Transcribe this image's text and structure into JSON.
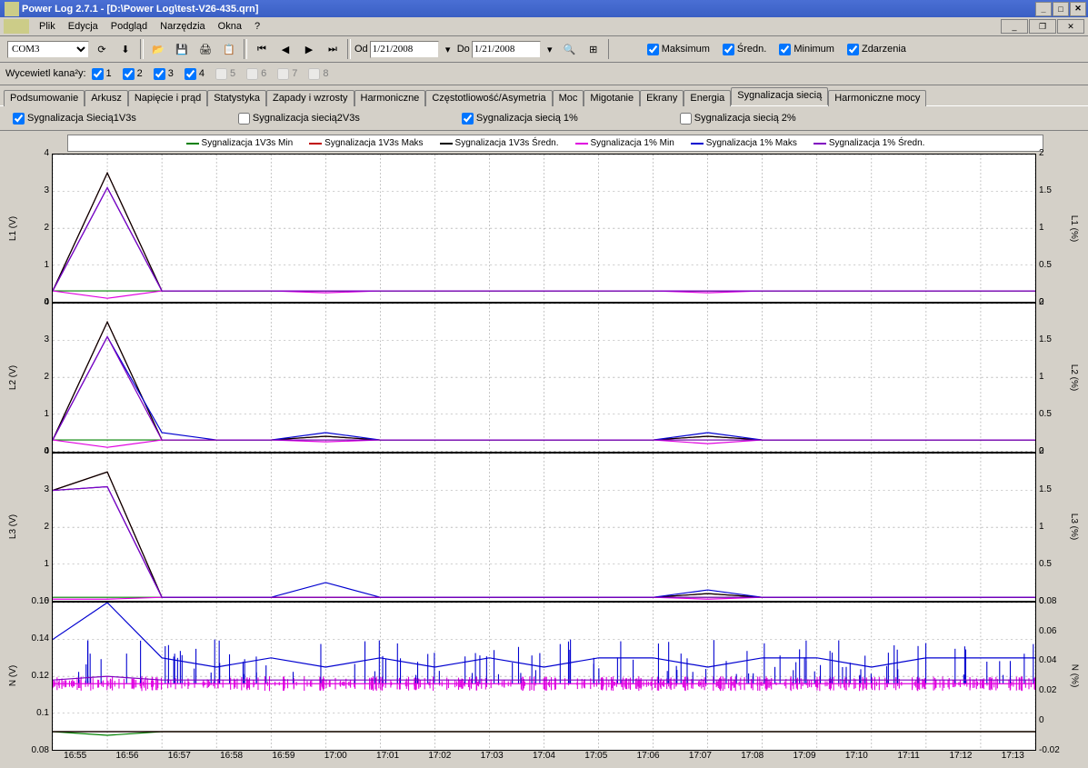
{
  "window": {
    "title": "Power Log 2.7.1 - [D:\\Power Log\\test-V26-435.qrn]"
  },
  "menu": {
    "file": "Plik",
    "edit": "Edycja",
    "view": "Podgląd",
    "tools": "Narzędzia",
    "windows": "Okna",
    "help": "?"
  },
  "toolbar": {
    "port": "COM3",
    "from_lbl": "Od",
    "from": "1/21/2008",
    "to_lbl": "Do",
    "to": "1/21/2008",
    "max": "Maksimum",
    "avg": "Średn.",
    "min": "Minimum",
    "events": "Zdarzenia"
  },
  "channels": {
    "label": "Wycewietl kana²y:",
    "c1": "1",
    "c2": "2",
    "c3": "3",
    "c4": "4",
    "c5": "5",
    "c6": "6",
    "c7": "7",
    "c8": "8"
  },
  "tabs": {
    "summary": "Podsumowanie",
    "sheet": "Arkusz",
    "vi": "Napięcie i prąd",
    "stats": "Statystyka",
    "dips": "Zapady i wzrosty",
    "harm": "Harmoniczne",
    "freq": "Częstotliowość/Asymetria",
    "power": "Moc",
    "flicker": "Migotanie",
    "screens": "Ekrany",
    "energy": "Energia",
    "mains": "Sygnalizacja siecią",
    "pharm": "Harmoniczne mocy"
  },
  "subopts": {
    "s1": "Sygnalizacja Siecią1V3s",
    "s2": "Sygnalizacja siecią2V3s",
    "s3": "Sygnalizacja siecią 1%",
    "s4": "Sygnalizacja siecią 2%"
  },
  "legend": {
    "l1": "Sygnalizacja 1V3s Min",
    "l2": "Sygnalizacja 1V3s Maks",
    "l3": "Sygnalizacja 1V3s Średn.",
    "l4": "Sygnalizacja 1% Min",
    "l5": "Sygnalizacja 1% Maks",
    "l6": "Sygnalizacja 1% Średn."
  },
  "axes": {
    "L1": "L1 (V)",
    "L2": "L2 (V)",
    "L3": "L3 (V)",
    "N": "N (V)",
    "L1r": "L1 (%)",
    "L2r": "L2 (%)",
    "L3r": "L3 (%)",
    "Nr": "N (%)"
  },
  "yticksV": [
    "0",
    "1",
    "2",
    "3",
    "4"
  ],
  "yticksVr": [
    "0",
    "0.5",
    "1",
    "1.5",
    "2"
  ],
  "yticksN": [
    "0.08",
    "0.1",
    "0.12",
    "0.14",
    "0.16"
  ],
  "yticksNr": [
    "-0.02",
    "0",
    "0.02",
    "0.04",
    "0.06",
    "0.08"
  ],
  "xticks": [
    "16:55",
    "16:56",
    "16:57",
    "16:58",
    "16:59",
    "17:00",
    "17:01",
    "17:02",
    "17:03",
    "17:04",
    "17:05",
    "17:06",
    "17:07",
    "17:08",
    "17:09",
    "17:10",
    "17:11",
    "17:12",
    "17:13"
  ],
  "chart_data": [
    {
      "type": "line",
      "name": "L1",
      "ylabel": "L1 (V)",
      "ylim": [
        0,
        4
      ],
      "ylim_r": [
        0,
        2
      ],
      "x": [
        "16:55",
        "16:56",
        "16:57",
        "16:58",
        "16:59",
        "17:00",
        "17:01",
        "17:02",
        "17:03",
        "17:04",
        "17:05",
        "17:06",
        "17:07",
        "17:08",
        "17:09",
        "17:10",
        "17:11",
        "17:12",
        "17:13"
      ],
      "series": [
        {
          "name": "Sygnalizacja 1V3s Min",
          "color": "#008000",
          "values": [
            0.3,
            0.3,
            0.3,
            0.3,
            0.3,
            0.3,
            0.3,
            0.3,
            0.3,
            0.3,
            0.3,
            0.3,
            0.3,
            0.3,
            0.3,
            0.3,
            0.3,
            0.3,
            0.3
          ]
        },
        {
          "name": "Sygnalizacja 1V3s Maks",
          "color": "#c00000",
          "values": [
            0.3,
            3.5,
            0.3,
            0.3,
            0.3,
            0.3,
            0.3,
            0.3,
            0.3,
            0.3,
            0.3,
            0.3,
            0.3,
            0.3,
            0.3,
            0.3,
            0.3,
            0.3,
            0.3
          ]
        },
        {
          "name": "Sygnalizacja 1V3s Średn.",
          "color": "#000000",
          "values": [
            0.3,
            3.5,
            0.3,
            0.3,
            0.3,
            0.3,
            0.3,
            0.3,
            0.3,
            0.3,
            0.3,
            0.3,
            0.3,
            0.3,
            0.3,
            0.3,
            0.3,
            0.3,
            0.3
          ]
        },
        {
          "name": "Sygnalizacja 1% Min",
          "color": "#e000e0",
          "values": [
            0.3,
            0.1,
            0.3,
            0.3,
            0.3,
            0.25,
            0.3,
            0.3,
            0.3,
            0.3,
            0.3,
            0.3,
            0.25,
            0.3,
            0.3,
            0.3,
            0.3,
            0.3,
            0.3
          ]
        },
        {
          "name": "Sygnalizacja 1% Maks",
          "color": "#0000d0",
          "values": [
            0.3,
            3.1,
            0.3,
            0.3,
            0.3,
            0.3,
            0.3,
            0.3,
            0.3,
            0.3,
            0.3,
            0.3,
            0.3,
            0.3,
            0.3,
            0.3,
            0.3,
            0.3,
            0.3
          ]
        },
        {
          "name": "Sygnalizacja 1% Średn.",
          "color": "#8000c0",
          "values": [
            0.3,
            3.1,
            0.3,
            0.3,
            0.3,
            0.3,
            0.3,
            0.3,
            0.3,
            0.3,
            0.3,
            0.3,
            0.3,
            0.3,
            0.3,
            0.3,
            0.3,
            0.3,
            0.3
          ]
        }
      ]
    },
    {
      "type": "line",
      "name": "L2",
      "ylabel": "L2 (V)",
      "ylim": [
        0,
        4
      ],
      "ylim_r": [
        0,
        2
      ],
      "x": [
        "16:55",
        "16:56",
        "16:57",
        "16:58",
        "16:59",
        "17:00",
        "17:01",
        "17:02",
        "17:03",
        "17:04",
        "17:05",
        "17:06",
        "17:07",
        "17:08",
        "17:09",
        "17:10",
        "17:11",
        "17:12",
        "17:13"
      ],
      "series": [
        {
          "name": "Sygnalizacja 1V3s Min",
          "color": "#008000",
          "values": [
            0.3,
            0.3,
            0.3,
            0.3,
            0.3,
            0.3,
            0.3,
            0.3,
            0.3,
            0.3,
            0.3,
            0.3,
            0.3,
            0.3,
            0.3,
            0.3,
            0.3,
            0.3,
            0.3
          ]
        },
        {
          "name": "Sygnalizacja 1V3s Maks",
          "color": "#c00000",
          "values": [
            0.3,
            3.5,
            0.3,
            0.3,
            0.3,
            0.4,
            0.3,
            0.3,
            0.3,
            0.3,
            0.3,
            0.3,
            0.4,
            0.3,
            0.3,
            0.3,
            0.3,
            0.3,
            0.3
          ]
        },
        {
          "name": "Sygnalizacja 1V3s Średn.",
          "color": "#000000",
          "values": [
            0.3,
            3.5,
            0.3,
            0.3,
            0.3,
            0.4,
            0.3,
            0.3,
            0.3,
            0.3,
            0.3,
            0.3,
            0.4,
            0.3,
            0.3,
            0.3,
            0.3,
            0.3,
            0.3
          ]
        },
        {
          "name": "Sygnalizacja 1% Min",
          "color": "#e000e0",
          "values": [
            0.3,
            0.1,
            0.3,
            0.3,
            0.3,
            0.25,
            0.3,
            0.3,
            0.3,
            0.3,
            0.3,
            0.3,
            0.2,
            0.3,
            0.3,
            0.3,
            0.3,
            0.3,
            0.3
          ]
        },
        {
          "name": "Sygnalizacja 1% Maks",
          "color": "#0000d0",
          "values": [
            0.3,
            3.1,
            0.5,
            0.3,
            0.3,
            0.5,
            0.3,
            0.3,
            0.3,
            0.3,
            0.3,
            0.3,
            0.5,
            0.3,
            0.3,
            0.3,
            0.3,
            0.3,
            0.3
          ]
        },
        {
          "name": "Sygnalizacja 1% Średn.",
          "color": "#8000c0",
          "values": [
            0.3,
            3.1,
            0.3,
            0.3,
            0.3,
            0.3,
            0.3,
            0.3,
            0.3,
            0.3,
            0.3,
            0.3,
            0.3,
            0.3,
            0.3,
            0.3,
            0.3,
            0.3,
            0.3
          ]
        }
      ]
    },
    {
      "type": "line",
      "name": "L3",
      "ylabel": "L3 (V)",
      "ylim": [
        0,
        4
      ],
      "ylim_r": [
        0,
        2
      ],
      "x": [
        "16:55",
        "16:56",
        "16:57",
        "16:58",
        "16:59",
        "17:00",
        "17:01",
        "17:02",
        "17:03",
        "17:04",
        "17:05",
        "17:06",
        "17:07",
        "17:08",
        "17:09",
        "17:10",
        "17:11",
        "17:12",
        "17:13"
      ],
      "series": [
        {
          "name": "Sygnalizacja 1V3s Min",
          "color": "#008000",
          "values": [
            0.1,
            0.1,
            0.1,
            0.1,
            0.1,
            0.1,
            0.1,
            0.1,
            0.1,
            0.1,
            0.1,
            0.1,
            0.1,
            0.1,
            0.1,
            0.1,
            0.1,
            0.1,
            0.1
          ]
        },
        {
          "name": "Sygnalizacja 1V3s Maks",
          "color": "#c00000",
          "values": [
            3.0,
            3.5,
            0.1,
            0.1,
            0.1,
            0.1,
            0.1,
            0.1,
            0.1,
            0.1,
            0.1,
            0.1,
            0.2,
            0.1,
            0.1,
            0.1,
            0.1,
            0.1,
            0.1
          ]
        },
        {
          "name": "Sygnalizacja 1V3s Średn.",
          "color": "#000000",
          "values": [
            3.0,
            3.5,
            0.1,
            0.1,
            0.1,
            0.1,
            0.1,
            0.1,
            0.1,
            0.1,
            0.1,
            0.1,
            0.2,
            0.1,
            0.1,
            0.1,
            0.1,
            0.1,
            0.1
          ]
        },
        {
          "name": "Sygnalizacja 1% Min",
          "color": "#e000e0",
          "values": [
            0.05,
            0.05,
            0.1,
            0.1,
            0.1,
            0.1,
            0.1,
            0.1,
            0.1,
            0.1,
            0.1,
            0.1,
            0.05,
            0.1,
            0.1,
            0.1,
            0.1,
            0.1,
            0.1
          ]
        },
        {
          "name": "Sygnalizacja 1% Maks",
          "color": "#0000d0",
          "values": [
            3.0,
            3.1,
            0.1,
            0.1,
            0.1,
            0.5,
            0.1,
            0.1,
            0.1,
            0.1,
            0.1,
            0.1,
            0.3,
            0.1,
            0.1,
            0.1,
            0.1,
            0.1,
            0.1
          ]
        },
        {
          "name": "Sygnalizacja 1% Średn.",
          "color": "#8000c0",
          "values": [
            3.0,
            3.1,
            0.1,
            0.1,
            0.1,
            0.1,
            0.1,
            0.1,
            0.1,
            0.1,
            0.1,
            0.1,
            0.1,
            0.1,
            0.1,
            0.1,
            0.1,
            0.1,
            0.1
          ]
        }
      ]
    },
    {
      "type": "line",
      "name": "N",
      "ylabel": "N (V)",
      "ylim": [
        0.08,
        0.16
      ],
      "ylim_r": [
        -0.02,
        0.08
      ],
      "x": [
        "16:55",
        "16:56",
        "16:57",
        "16:58",
        "16:59",
        "17:00",
        "17:01",
        "17:02",
        "17:03",
        "17:04",
        "17:05",
        "17:06",
        "17:07",
        "17:08",
        "17:09",
        "17:10",
        "17:11",
        "17:12",
        "17:13"
      ],
      "series": [
        {
          "name": "Sygnalizacja 1V3s Min",
          "color": "#008000",
          "values": [
            0.09,
            0.088,
            0.09,
            0.09,
            0.09,
            0.09,
            0.09,
            0.09,
            0.09,
            0.09,
            0.09,
            0.09,
            0.09,
            0.09,
            0.09,
            0.09,
            0.09,
            0.09,
            0.09
          ]
        },
        {
          "name": "Sygnalizacja 1V3s Maks",
          "color": "#c00000",
          "values": [
            0.09,
            0.09,
            0.09,
            0.09,
            0.09,
            0.09,
            0.09,
            0.09,
            0.09,
            0.09,
            0.09,
            0.09,
            0.09,
            0.09,
            0.09,
            0.09,
            0.09,
            0.09,
            0.09
          ]
        },
        {
          "name": "Sygnalizacja 1V3s Średn.",
          "color": "#000000",
          "values": [
            0.09,
            0.09,
            0.09,
            0.09,
            0.09,
            0.09,
            0.09,
            0.09,
            0.09,
            0.09,
            0.09,
            0.09,
            0.09,
            0.09,
            0.09,
            0.09,
            0.09,
            0.09,
            0.09
          ]
        },
        {
          "name": "Sygnalizacja 1% Min",
          "color": "#e000e0",
          "values": [
            0.116,
            0.116,
            0.116,
            0.116,
            0.116,
            0.116,
            0.116,
            0.116,
            0.116,
            0.116,
            0.116,
            0.116,
            0.116,
            0.116,
            0.116,
            0.116,
            0.116,
            0.116,
            0.116
          ]
        },
        {
          "name": "Sygnalizacja 1% Maks",
          "color": "#0000d0",
          "values": [
            0.14,
            0.16,
            0.13,
            0.125,
            0.13,
            0.125,
            0.13,
            0.125,
            0.13,
            0.125,
            0.13,
            0.13,
            0.125,
            0.13,
            0.13,
            0.125,
            0.13,
            0.13,
            0.13
          ]
        },
        {
          "name": "Sygnalizacja 1% Średn.",
          "color": "#8000c0",
          "values": [
            0.118,
            0.12,
            0.118,
            0.118,
            0.118,
            0.118,
            0.118,
            0.118,
            0.118,
            0.118,
            0.118,
            0.118,
            0.118,
            0.118,
            0.118,
            0.118,
            0.118,
            0.118,
            0.118
          ]
        }
      ]
    }
  ]
}
